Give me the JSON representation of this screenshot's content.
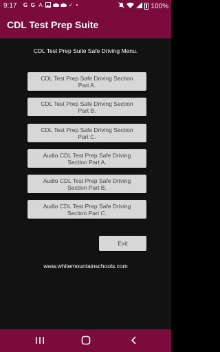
{
  "status_bar": {
    "time": "9:17",
    "battery": "100%",
    "left_icons": [
      "google-icon",
      "google-icon",
      "translate-icon",
      "image-icon",
      "cloud-icon",
      "cloud-icon",
      "check-icon",
      "dot-icon"
    ],
    "right_icons": [
      "mute-icon",
      "wifi-icon",
      "signal-icon",
      "battery-icon"
    ]
  },
  "app_bar": {
    "title": "CDL Test Prep Suite"
  },
  "content": {
    "heading": "CDL Test Prep Suite Safe Driving Menu.",
    "buttons": [
      {
        "line1": "CDL Test Prep Safe Driving Section",
        "line2": "Part A."
      },
      {
        "line1": "CDL Test Prep Safe Driving Section",
        "line2": "Part B."
      },
      {
        "line1": "CDL Test Prep Safe Driving Section",
        "line2": "Part C."
      },
      {
        "line1": "Audio CDL Test Prep Safe Driving",
        "line2": "Section Part A."
      },
      {
        "line1": "Audio CDL Test Prep Safe Driving",
        "line2": "Section Part B."
      },
      {
        "line1": "Audio CDL Test Prep Safe Driving",
        "line2": "Section Part C."
      }
    ],
    "exit_label": "Exit",
    "website": "www.whitemountainschools.com"
  },
  "nav_bar": {
    "items": [
      "recents-icon",
      "home-icon",
      "back-icon"
    ]
  },
  "colors": {
    "primary": "#7b0b3c",
    "background": "#121212",
    "button": "#d7d7d7",
    "button_text": "#454545"
  }
}
